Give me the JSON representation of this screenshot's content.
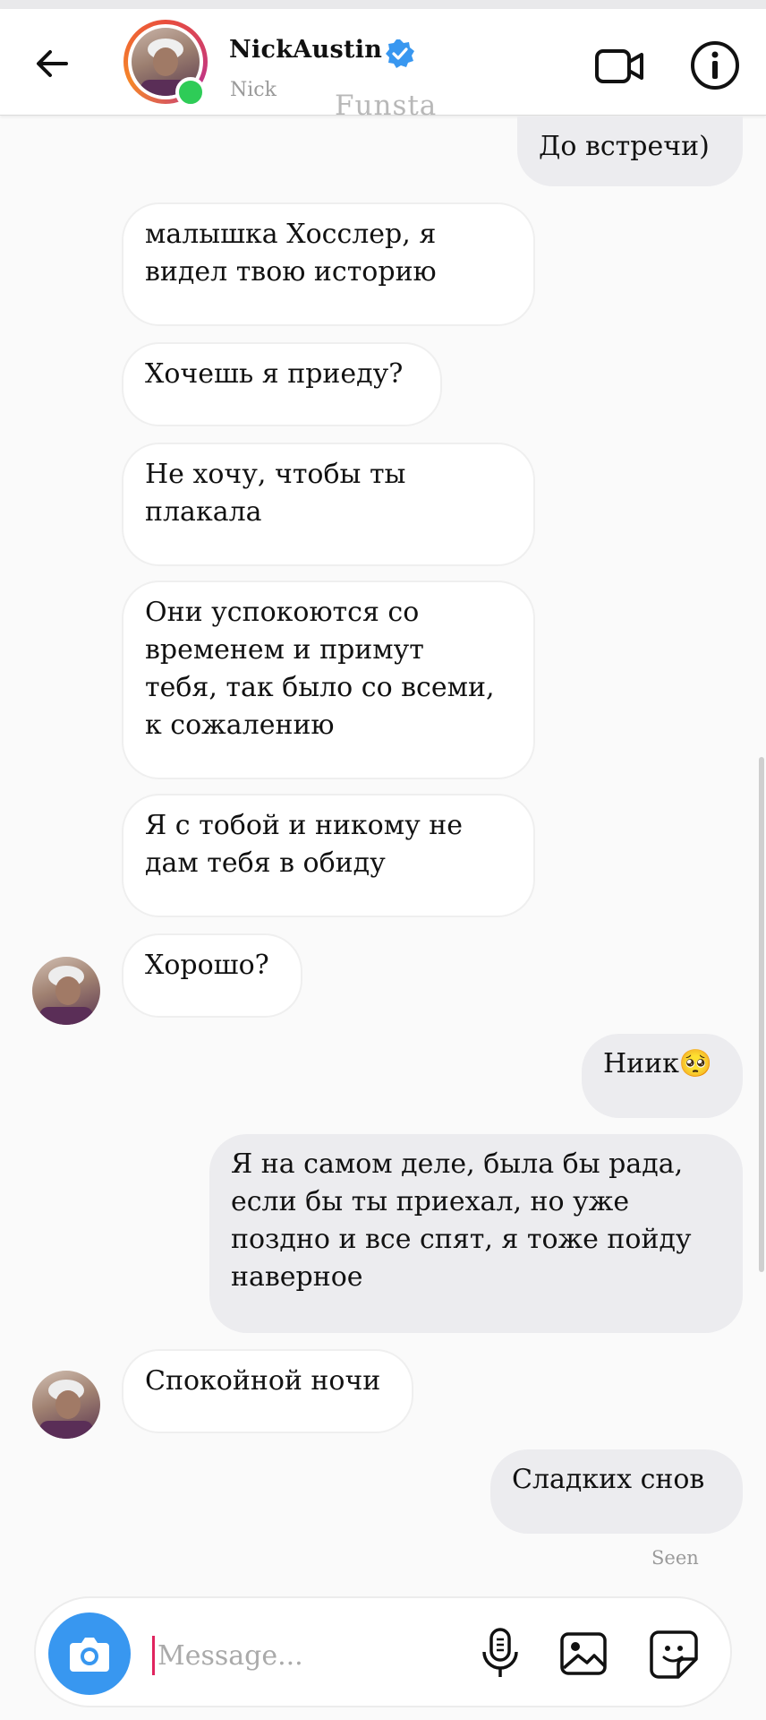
{
  "header": {
    "contact_name": "NickAustin",
    "contact_subtitle": "Nick",
    "watermark": "Funsta"
  },
  "messages": [
    {
      "direction": "outgoing",
      "text": "До встречи)"
    },
    {
      "direction": "incoming",
      "lines": [
        "малышка Хосслер, я",
        "видел твою историю"
      ]
    },
    {
      "direction": "incoming",
      "lines": [
        "Хочешь я приеду?"
      ]
    },
    {
      "direction": "incoming",
      "lines": [
        "Не хочу, чтобы ты",
        "плакала"
      ]
    },
    {
      "direction": "incoming",
      "lines": [
        "Они успокоются со",
        "временем и примут",
        "тебя, так было со всеми,",
        "к сожалению"
      ]
    },
    {
      "direction": "incoming",
      "lines": [
        "Я с тобой и никому не",
        "дам тебя в обиду"
      ]
    },
    {
      "direction": "incoming",
      "text": "Хорошо?"
    },
    {
      "direction": "outgoing",
      "text": "Ниик🥺"
    },
    {
      "direction": "outgoing",
      "lines": [
        "Я на самом деле, была бы рада,",
        "если бы ты приехал, но уже",
        "поздно и все спят, я тоже пойду",
        "наверное"
      ]
    },
    {
      "direction": "incoming",
      "text": "Спокойной ночи"
    },
    {
      "direction": "outgoing",
      "text": "Сладких снов"
    }
  ],
  "seen_label": "Seen",
  "composer": {
    "placeholder": "Message..."
  },
  "colors": {
    "accent_blue": "#3897f0",
    "online_green": "#2ecc57",
    "outgoing_bubble": "#ececef",
    "incoming_bubble": "#ffffff"
  },
  "icons": [
    "back-arrow-icon",
    "verified-badge-icon",
    "video-call-icon",
    "info-icon",
    "camera-icon",
    "microphone-icon",
    "gallery-icon",
    "sticker-icon"
  ]
}
